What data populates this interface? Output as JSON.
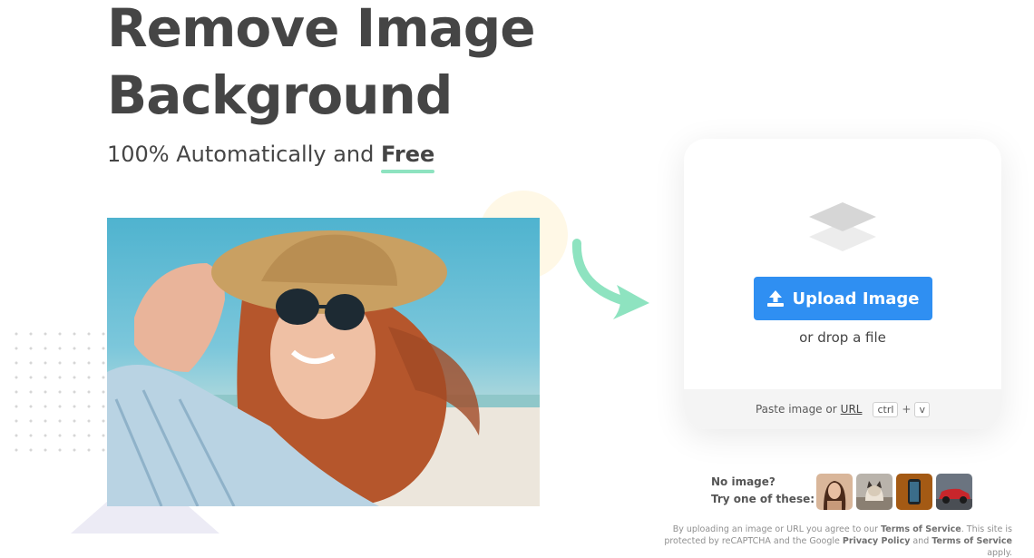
{
  "hero": {
    "title_line1": "Remove Image",
    "title_line2": "Background",
    "subtitle_prefix": "100% Automatically and",
    "subtitle_highlight": "Free"
  },
  "upload": {
    "button_label": "Upload Image",
    "drop_text": "or drop a file",
    "paste_text": "Paste image or",
    "url_link": "URL",
    "key_ctrl": "ctrl",
    "key_plus": "+",
    "key_v": "v"
  },
  "samples": {
    "line1": "No image?",
    "line2": "Try one of these:",
    "thumbnails": [
      "woman",
      "cat",
      "phone",
      "car"
    ]
  },
  "legal": {
    "part1": "By uploading an image or URL you agree to our",
    "terms1": "Terms of Service",
    "part2": ". This site is protected by reCAPTCHA and the Google",
    "privacy": "Privacy Policy",
    "part3": "and",
    "terms2": "Terms of Service",
    "part4": "apply."
  },
  "colors": {
    "primary_button": "#2f8ff2",
    "accent_green": "#8ee3c0",
    "heading": "#454545"
  },
  "icons": {
    "upload_button_icon": "upload-icon",
    "card_icon": "layers-icon",
    "arrow": "curved-arrow-icon"
  }
}
